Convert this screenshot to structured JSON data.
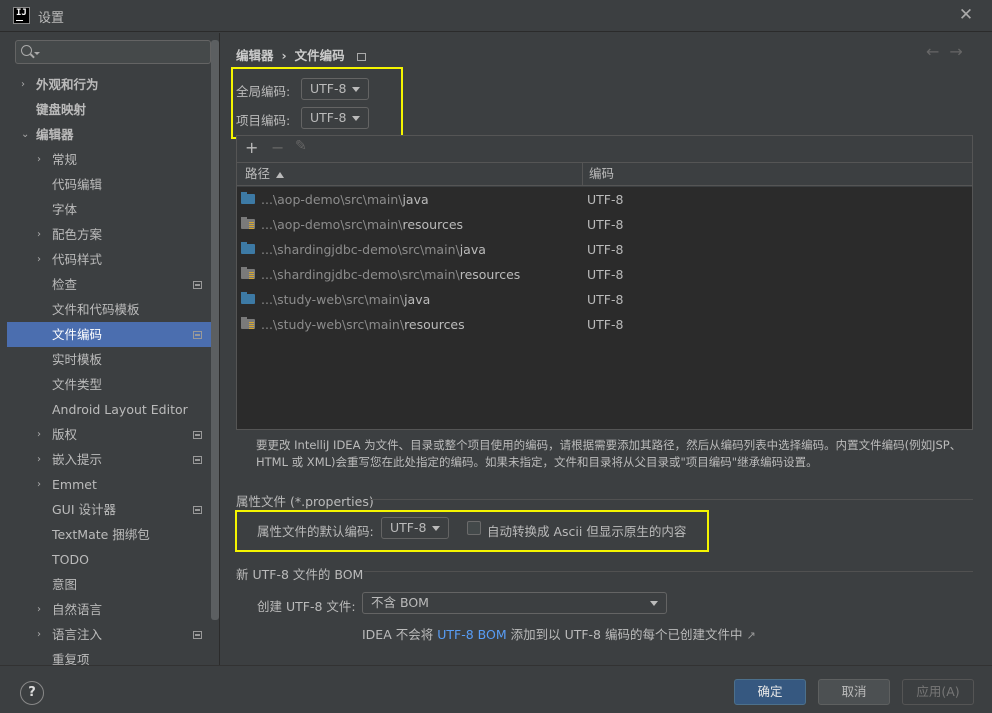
{
  "window": {
    "title": "设置",
    "logo_text": "IJ"
  },
  "search": {
    "placeholder": ""
  },
  "sidebar": {
    "items": [
      {
        "label": "外观和行为",
        "level": 0,
        "arrow": "›",
        "bold": true
      },
      {
        "label": "键盘映射",
        "level": 0,
        "arrow": "",
        "bold": true
      },
      {
        "label": "编辑器",
        "level": 0,
        "arrow": "⌄",
        "bold": true
      },
      {
        "label": "常规",
        "level": 1,
        "arrow": "›"
      },
      {
        "label": "代码编辑",
        "level": 1,
        "arrow": ""
      },
      {
        "label": "字体",
        "level": 1,
        "arrow": ""
      },
      {
        "label": "配色方案",
        "level": 1,
        "arrow": "›"
      },
      {
        "label": "代码样式",
        "level": 1,
        "arrow": "›"
      },
      {
        "label": "检查",
        "level": 1,
        "arrow": "",
        "badge": true
      },
      {
        "label": "文件和代码模板",
        "level": 1,
        "arrow": ""
      },
      {
        "label": "文件编码",
        "level": 1,
        "arrow": "",
        "badge": true,
        "selected": true
      },
      {
        "label": "实时模板",
        "level": 1,
        "arrow": ""
      },
      {
        "label": "文件类型",
        "level": 1,
        "arrow": ""
      },
      {
        "label": "Android Layout Editor",
        "level": 1,
        "arrow": ""
      },
      {
        "label": "版权",
        "level": 1,
        "arrow": "›",
        "badge": true
      },
      {
        "label": "嵌入提示",
        "level": 1,
        "arrow": "›",
        "badge": true
      },
      {
        "label": "Emmet",
        "level": 1,
        "arrow": "›"
      },
      {
        "label": "GUI 设计器",
        "level": 1,
        "arrow": "",
        "badge": true
      },
      {
        "label": "TextMate 捆绑包",
        "level": 1,
        "arrow": ""
      },
      {
        "label": "TODO",
        "level": 1,
        "arrow": ""
      },
      {
        "label": "意图",
        "level": 1,
        "arrow": ""
      },
      {
        "label": "自然语言",
        "level": 1,
        "arrow": "›"
      },
      {
        "label": "语言注入",
        "level": 1,
        "arrow": "›",
        "badge": true
      },
      {
        "label": "重复项",
        "level": 1,
        "arrow": ""
      }
    ]
  },
  "breadcrumb": {
    "parent": "编辑器",
    "separator": "›",
    "current": "文件编码",
    "nav_back": "←",
    "nav_forward": "→"
  },
  "encoding": {
    "global_label": "全局编码:",
    "global_value": "UTF-8",
    "project_label": "项目编码:",
    "project_value": "UTF-8"
  },
  "table": {
    "tools": {
      "add": "+",
      "remove": "−",
      "edit": "✎"
    },
    "headers": {
      "path": "路径",
      "encoding": "编码"
    },
    "rows": [
      {
        "prefix": "...\\aop-demo\\src\\main\\",
        "leaf": "java",
        "encoding": "UTF-8",
        "type": "source"
      },
      {
        "prefix": "...\\aop-demo\\src\\main\\",
        "leaf": "resources",
        "encoding": "UTF-8",
        "type": "resource"
      },
      {
        "prefix": "...\\shardingjdbc-demo\\src\\main\\",
        "leaf": "java",
        "encoding": "UTF-8",
        "type": "source"
      },
      {
        "prefix": "...\\shardingjdbc-demo\\src\\main\\",
        "leaf": "resources",
        "encoding": "UTF-8",
        "type": "resource"
      },
      {
        "prefix": "...\\study-web\\src\\main\\",
        "leaf": "java",
        "encoding": "UTF-8",
        "type": "source"
      },
      {
        "prefix": "...\\study-web\\src\\main\\",
        "leaf": "resources",
        "encoding": "UTF-8",
        "type": "resource"
      }
    ]
  },
  "note": "要更改 IntelliJ IDEA 为文件、目录或整个项目使用的编码，请根据需要添加其路径，然后从编码列表中选择编码。内置文件编码(例如JSP、HTML 或 XML)会重写您在此处指定的编码。如果未指定，文件和目录将从父目录或\"项目编码\"继承编码设置。",
  "properties": {
    "section_title": "属性文件 (*.properties)",
    "default_label": "属性文件的默认编码:",
    "default_value": "UTF-8",
    "ascii_label": "自动转换成 Ascii 但显示原生的内容",
    "ascii_checked": false
  },
  "bom": {
    "section_title": "新 UTF-8 文件的 BOM",
    "create_label": "创建 UTF-8 文件:",
    "create_value": "不含 BOM",
    "info_before": "IDEA 不会将 ",
    "info_link": "UTF-8 BOM",
    "info_after": " 添加到以 UTF-8 编码的每个已创建文件中",
    "info_arrow": "↗"
  },
  "footer": {
    "help": "?",
    "ok": "确定",
    "cancel": "取消",
    "apply": "应用(A)"
  },
  "colors": {
    "selection": "#4b6eaf",
    "highlight_box": "#f5f500",
    "link": "#589df6",
    "primary_button": "#365880"
  }
}
